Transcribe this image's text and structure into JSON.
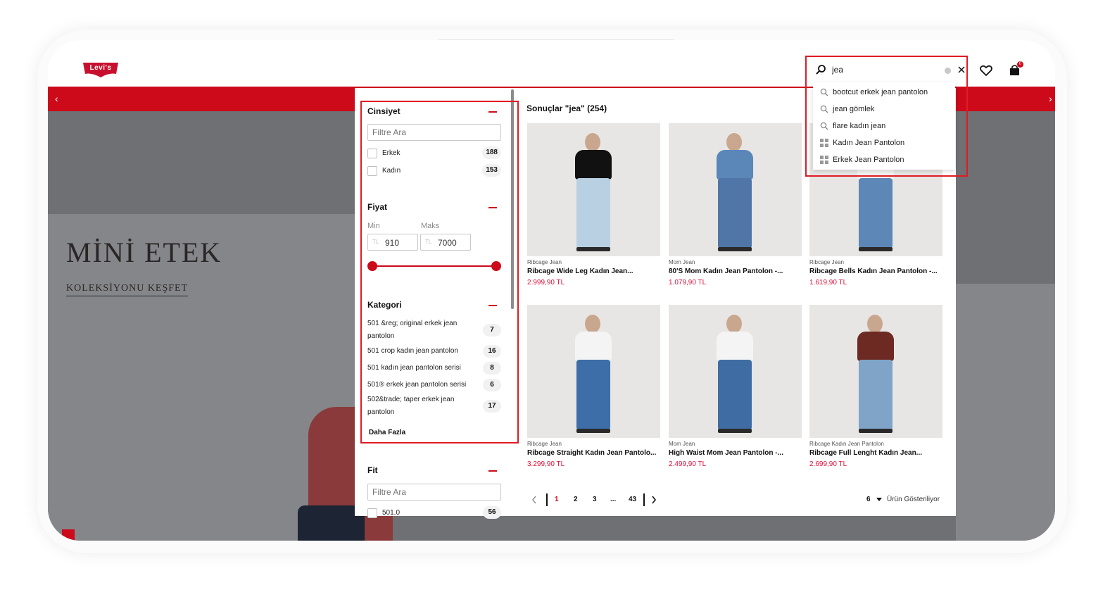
{
  "header": {
    "logo_text": "Levi's",
    "cart_count": "0"
  },
  "hero": {
    "title": "MİNİ ETEK",
    "link": "KOLEKSİYONU KEŞFET"
  },
  "search": {
    "value": "jea",
    "suggestions": [
      {
        "label": "bootcut erkek jean pantolon",
        "icon": "search-icon"
      },
      {
        "label": "jean gömlek",
        "icon": "search-icon"
      },
      {
        "label": "flare kadın jean",
        "icon": "search-icon"
      },
      {
        "label": "Kadın Jean Pantolon",
        "icon": "grid-icon"
      },
      {
        "label": "Erkek Jean Pantolon",
        "icon": "grid-icon"
      }
    ]
  },
  "filters": {
    "gender": {
      "heading": "Cinsiyet",
      "search_placeholder": "Filtre Ara",
      "options": [
        {
          "label": "Erkek",
          "count": "188"
        },
        {
          "label": "Kadın",
          "count": "153"
        }
      ]
    },
    "price": {
      "heading": "Fiyat",
      "min_label": "Min",
      "max_label": "Maks",
      "currency": "TL",
      "min_value": "910",
      "max_value": "7000"
    },
    "category": {
      "heading": "Kategori",
      "items": [
        {
          "label": "501 &reg; original erkek jean pantolon",
          "count": "7"
        },
        {
          "label": "501 crop kadın jean pantolon",
          "count": "16"
        },
        {
          "label": "501 kadın jean pantolon serisi",
          "count": "8"
        },
        {
          "label": "501® erkek jean pantolon serisi",
          "count": "6"
        },
        {
          "label": "502&trade; taper erkek jean pantolon",
          "count": "17"
        }
      ],
      "more": "Daha Fazla"
    },
    "fit": {
      "heading": "Fit",
      "search_placeholder": "Filtre Ara",
      "options": [
        {
          "label": "501.0",
          "count": "56"
        }
      ]
    }
  },
  "results": {
    "title": "Sonuçlar \"jea\" (254)",
    "products": [
      {
        "line": "Ribcage Jean",
        "name": "Ribcage Wide Leg Kadın Jean...",
        "price": "2.999,90 TL",
        "top_color": "#111111",
        "leg_color": "#b9d0e2"
      },
      {
        "line": "Mom Jean",
        "name": "80'S Mom Kadın Jean Pantolon -...",
        "price": "1.079,90 TL",
        "top_color": "#5b86b8",
        "leg_color": "#4f76a6"
      },
      {
        "line": "Ribcage Jean",
        "name": "Ribcage Bells Kadın Jean Pantolon -...",
        "price": "1.619,90 TL",
        "top_color": "#f2f2f2",
        "leg_color": "#5c87b6"
      },
      {
        "line": "Ribcage Jean",
        "name": "Ribcage Straight Kadın Jean Pantolo...",
        "price": "3.299,90 TL",
        "top_color": "#f4f4f4",
        "leg_color": "#3d6ea8"
      },
      {
        "line": "Mom Jean",
        "name": "High Waist Mom Jean Pantolon -...",
        "price": "2.499,90 TL",
        "top_color": "#f4f4f4",
        "leg_color": "#3f6da3"
      },
      {
        "line": "Ribcage Kadın Jean Pantolon",
        "name": "Ribcage Full Lenght Kadın Jean...",
        "price": "2.699,90 TL",
        "top_color": "#6d2a22",
        "leg_color": "#7fa4c8"
      }
    ],
    "pagination": {
      "pages": [
        "1",
        "2",
        "3",
        "...",
        "43"
      ],
      "active": "1"
    },
    "per_page": "6",
    "per_page_label": "Ürün Gösteriliyor"
  },
  "colors": {
    "brand_red": "#cc0a1a",
    "price_red": "#e0113a",
    "highlight": "#e01b24"
  }
}
